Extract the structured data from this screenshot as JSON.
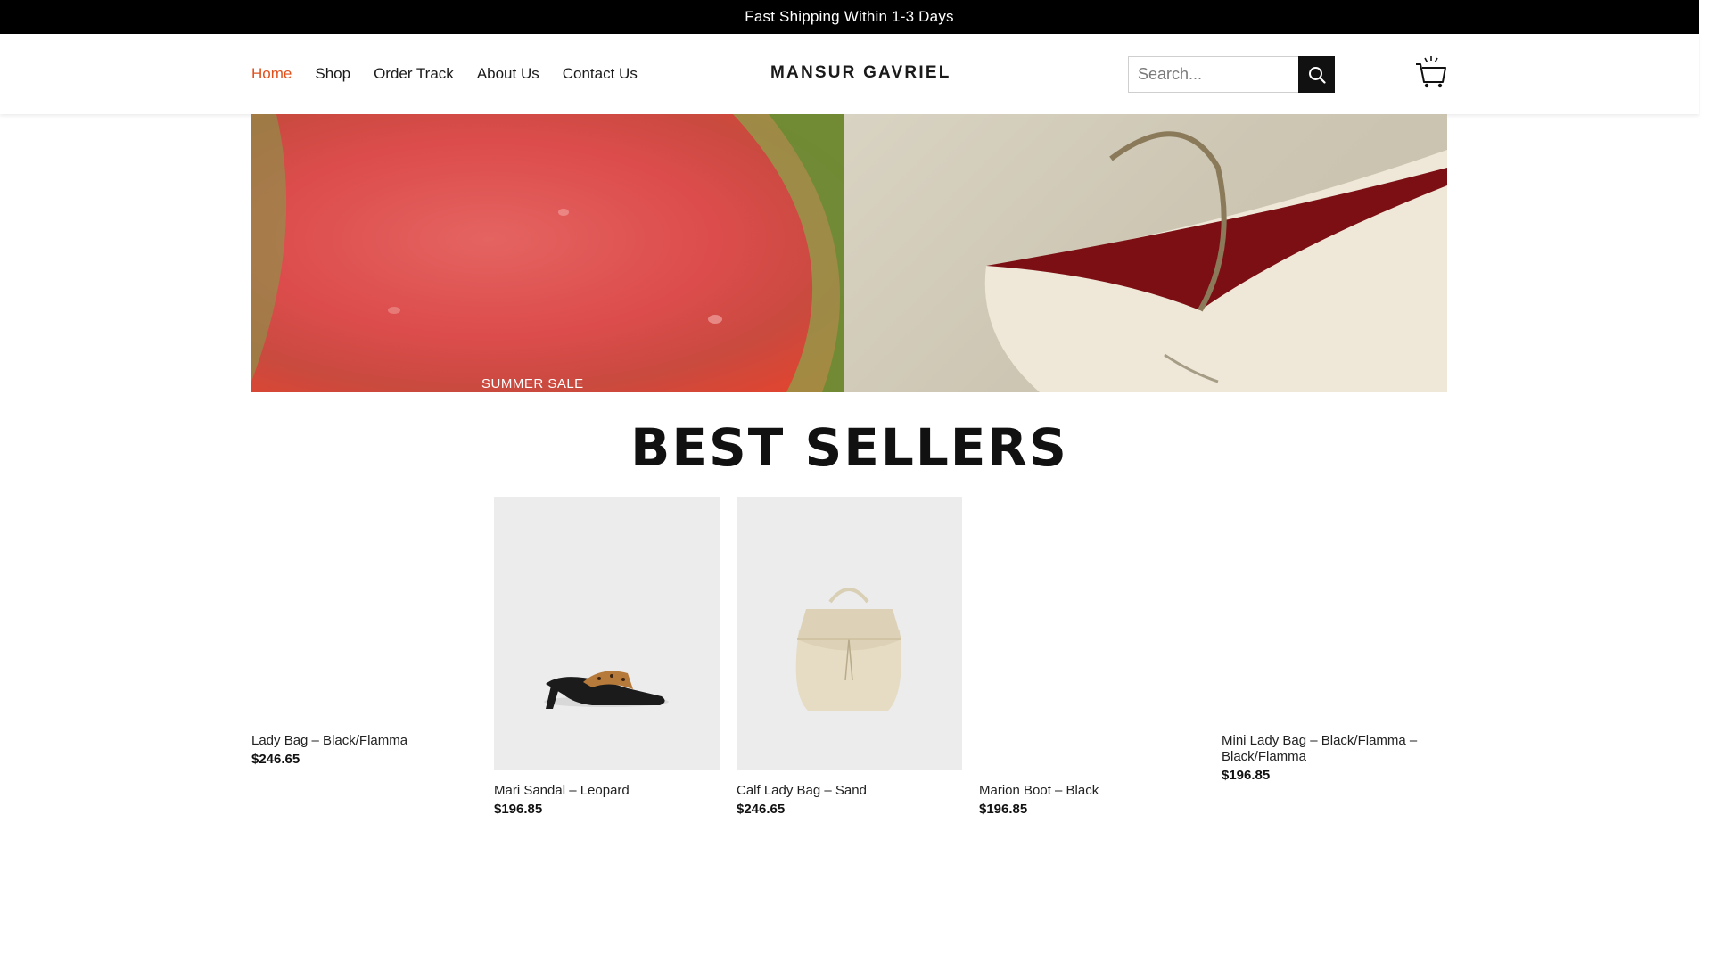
{
  "announcement": "Fast Shipping Within 1-3 Days",
  "nav": {
    "items": [
      "Home",
      "Shop",
      "Order Track",
      "About Us",
      "Contact Us"
    ],
    "active": "Home"
  },
  "brand": "MANSUR GAVRIEL",
  "search": {
    "placeholder": "Search..."
  },
  "banner": {
    "caption": "SUMMER SALE"
  },
  "section_title": "BEST SELLERS",
  "products": [
    {
      "name": "Lady Bag – Black/Flamma",
      "price": "$246.65"
    },
    {
      "name": "Mari Sandal – Leopard",
      "price": "$196.85"
    },
    {
      "name": "Calf Lady Bag – Sand",
      "price": "$246.65"
    },
    {
      "name": "Marion Boot – Black",
      "price": "$196.85"
    },
    {
      "name": "Mini Lady Bag – Black/Flamma – Black/Flamma",
      "price": "$196.85"
    }
  ],
  "colors": {
    "accent": "#e0501c",
    "topbar": "#000000"
  }
}
